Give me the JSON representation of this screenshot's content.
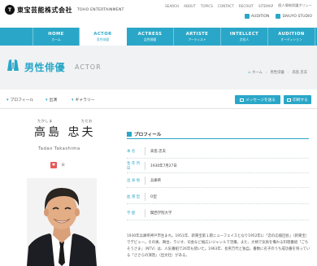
{
  "header": {
    "logo_mark": "T",
    "logo_jp": "東宝芸能株式会社",
    "logo_en": "TOHO ENTERTAINMENT",
    "top_links": [
      "SEARCH",
      "ABOUT",
      "TOPICS",
      "CONTACT",
      "RECRUIT",
      "SITEMAP",
      "個人情報保護ポリシー"
    ],
    "sub_links": [
      "AUDITION",
      "DAIUYO STUDIO"
    ]
  },
  "nav": {
    "items": [
      {
        "en": "HOME",
        "jp": "ホーム"
      },
      {
        "en": "ACTOR",
        "jp": "男性俳優"
      },
      {
        "en": "ACTRESS",
        "jp": "女性俳優"
      },
      {
        "en": "ARTISTE",
        "jp": "アーティスト"
      },
      {
        "en": "INTELLECT",
        "jp": "文化人"
      },
      {
        "en": "AUDITION",
        "jp": "オーディション"
      }
    ]
  },
  "page": {
    "title": "男性俳優",
    "title_en": "ACTOR",
    "breadcrumb": [
      "ホーム",
      "男性俳優",
      "高島 忠夫"
    ]
  },
  "tools": {
    "profile": "プロフィール",
    "works": "出演",
    "gallery": "ギャラリー",
    "message_btn": "メッセージを送る",
    "print_btn": "印刷する"
  },
  "actor": {
    "furigana_family": "たかしま",
    "furigana_given": "ただお",
    "name": "高島 忠夫",
    "name_en": "Tadao Takashima",
    "badge": "♥"
  },
  "profile": {
    "heading": "プロフィール",
    "rows": [
      {
        "key": "本名",
        "value": "高島 忠夫"
      },
      {
        "key": "生年月日",
        "value": "1930年7月27日"
      },
      {
        "key": "出身地",
        "value": "兵庫県"
      },
      {
        "key": "血液型",
        "value": "O型"
      },
      {
        "key": "学歴",
        "value": "関西学院大学"
      }
    ],
    "bio": "1930年兵庫県神戸市生まれ。1951年、新東宝第１期ニューフェイスとなり1952年に「恋の応援団長」（新東宝）でデビュー。その後、舞台、ラジオ、司会など幅広いジャンルで活躍。また、大柄で気負を備わる料理番組「ごちそうさま」（NTV）は、人気番組で26年も続いた。1963年、長男万代と独自。番数に名子のうち成功番を残っている「ささらの演習」（出文社）がある。"
  },
  "colors": {
    "accent": "#2aa7c8",
    "badge": "#e45a5a"
  }
}
